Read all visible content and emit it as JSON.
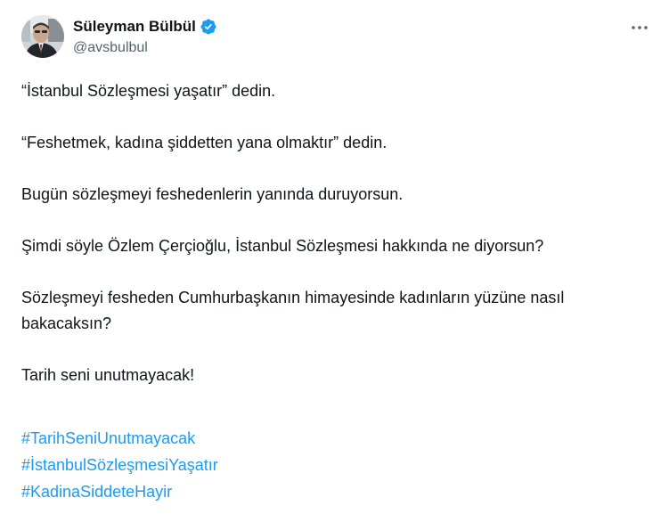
{
  "author": {
    "display_name": "Süleyman Bülbül",
    "handle": "@avsbulbul",
    "verified": true,
    "avatar_icon": "profile-photo"
  },
  "menu": {
    "icon": "more-horizontal-icon"
  },
  "tweet": {
    "paragraphs": [
      "“İstanbul Sözleşmesi yaşatır” dedin.",
      "“Feshetmek, kadına şiddetten yana olmaktır” dedin.",
      "Bugün sözleşmeyi feshedenlerin yanında duruyorsun.",
      "Şimdi söyle Özlem Çerçioğlu, İstanbul Sözleşmesi hakkında ne diyorsun?",
      "Sözleşmeyi fesheden Cumhurbaşkanın himayesinde kadınların yüzüne nasıl bakacaksın?",
      "Tarih seni unutmayacak!"
    ],
    "hashtags": [
      "#TarihSeniUnutmayacak",
      "#İstanbulSözleşmesiYaşatır",
      "#KadinaSiddeteHayir"
    ]
  },
  "colors": {
    "text": "#0f1419",
    "secondary": "#536471",
    "link": "#1d9bf0",
    "verified_badge": "#1d9bf0"
  }
}
